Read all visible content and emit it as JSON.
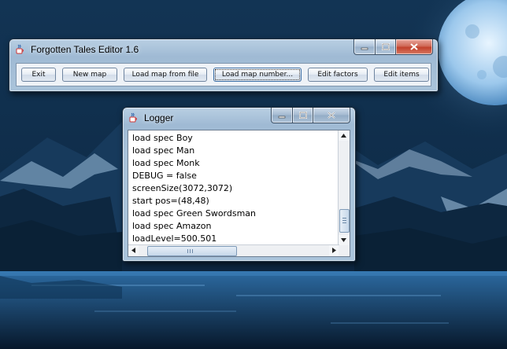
{
  "main_window": {
    "title": "Forgotten Tales Editor 1.6",
    "buttons": {
      "exit": "Exit",
      "new_map": "New map",
      "load_map_from_file": "Load map from file",
      "load_map_number": "Load map number...",
      "edit_factors": "Edit factors",
      "edit_items": "Edit items"
    },
    "focused_button": "load_map_number"
  },
  "logger_window": {
    "title": "Logger",
    "lines": [
      "load spec Boy",
      "load spec Man",
      "load spec Monk",
      "DEBUG = false",
      "screenSize(3072,3072)",
      "start pos=(48,48)",
      "load spec Green Swordsman",
      "load spec Amazon",
      "loadLevel=500.501"
    ]
  },
  "icons": {
    "app_icon": "java-cup-icon",
    "minimize": "minimize-icon",
    "maximize": "maximize-icon",
    "close": "close-icon",
    "scroll_up": "arrow-up-icon",
    "scroll_down": "arrow-down-icon",
    "scroll_left": "arrow-left-icon",
    "scroll_right": "arrow-right-icon"
  },
  "colors": {
    "title_bar": "#a9c3da",
    "close_button": "#c2412c",
    "desktop": "#0b1b2e"
  }
}
